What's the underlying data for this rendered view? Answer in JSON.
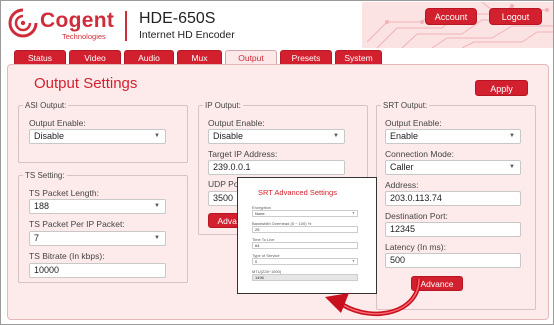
{
  "header": {
    "logo_text": "Cogent",
    "logo_sub": "Technologies",
    "product": "HDE-650S",
    "product_sub": "Internet HD Encoder",
    "account_label": "Account",
    "logout_label": "Logout"
  },
  "tabs": [
    {
      "label": "Status"
    },
    {
      "label": "Video"
    },
    {
      "label": "Audio"
    },
    {
      "label": "Mux"
    },
    {
      "label": "Output",
      "active": true
    },
    {
      "label": "Presets"
    },
    {
      "label": "System"
    }
  ],
  "page": {
    "title": "Output Settings",
    "apply_label": "Apply"
  },
  "asi": {
    "legend": "ASI Output:",
    "enable_label": "Output Enable:",
    "enable_value": "Disable"
  },
  "ts": {
    "legend": "TS Setting:",
    "packet_length_label": "TS Packet Length:",
    "packet_length_value": "188",
    "packet_per_label": "TS Packet Per IP Packet:",
    "packet_per_value": "7",
    "bitrate_label": "TS Bitrate (In kbps):",
    "bitrate_value": "10000"
  },
  "ip": {
    "legend": "IP Output:",
    "enable_label": "Output Enable:",
    "enable_value": "Disable",
    "target_label": "Target IP Address:",
    "target_value": "239.0.0.1",
    "port_label": "UDP Port:",
    "port_value": "3500",
    "advance_label": "Advance"
  },
  "srt": {
    "legend": "SRT Output:",
    "enable_label": "Output Enable:",
    "enable_value": "Enable",
    "mode_label": "Connection Mode:",
    "mode_value": "Caller",
    "address_label": "Address:",
    "address_value": "203.0.113.74",
    "dest_port_label": "Destination Port:",
    "dest_port_value": "12345",
    "latency_label": "Latency (In ms):",
    "latency_value": "500",
    "advance_label": "Advance"
  },
  "popup": {
    "title": "SRT Advanced Settings",
    "encryption_label": "Encryption",
    "encryption_value": "None",
    "overhead_label": "Bandwidth Overhead (5 ~ 100) %",
    "overhead_value": "25",
    "ttl_label": "Time To Live",
    "ttl_value": "64",
    "tos_label": "Type of Service",
    "tos_value": "0",
    "mtu_label": "MTU(228~1500)",
    "mtu_value": "1496"
  },
  "colors": {
    "brand_red": "#d3202e",
    "panel_bg": "#fdebec"
  }
}
